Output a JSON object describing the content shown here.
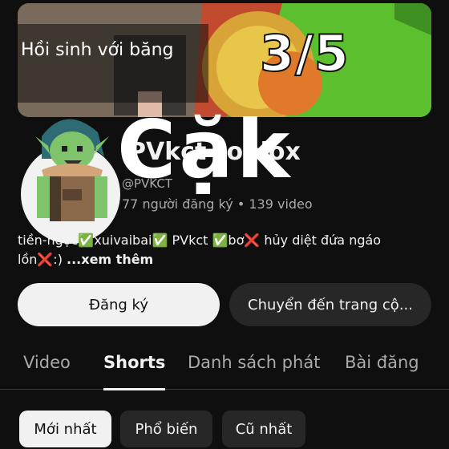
{
  "banner": {
    "caption": "Hồi sinh với băng",
    "counter": "3/5"
  },
  "channel": {
    "name": "PVkct roblox",
    "overlay_text": "Cặk",
    "handle": "@PVKCT",
    "subscribers": "77 người đăng ký",
    "separator": "•",
    "videos": "139 video",
    "description_line1": "tiền-ngọc✅xuivaibai✅ PVkct ✅bơ❌ hủy diệt đứa ngáo",
    "description_line2": "lồn❌:) ",
    "more_label": "...xem thêm"
  },
  "buttons": {
    "subscribe": "Đăng ký",
    "community": "Chuyển đến trang cộ..."
  },
  "tabs": [
    {
      "label": "Video",
      "active": false
    },
    {
      "label": "Shorts",
      "active": true
    },
    {
      "label": "Danh sách phát",
      "active": false
    },
    {
      "label": "Bài đăng",
      "active": false
    }
  ],
  "filters": [
    {
      "label": "Mới nhất",
      "selected": true
    },
    {
      "label": "Phổ biến",
      "selected": false
    },
    {
      "label": "Cũ nhất",
      "selected": false
    }
  ],
  "colors": {
    "background": "#0f0f0f",
    "text_primary": "#f1f1f1",
    "text_secondary": "#aaaaaa",
    "chip_dark": "#272727"
  }
}
